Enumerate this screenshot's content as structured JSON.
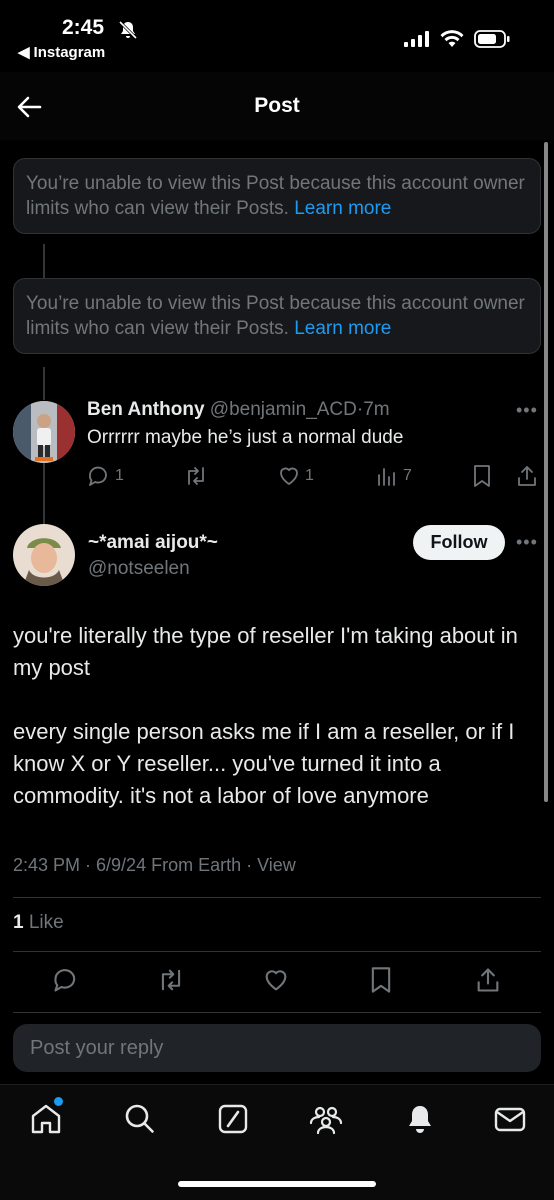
{
  "status": {
    "time": "2:45",
    "back_app": "Instagram"
  },
  "header": {
    "title": "Post"
  },
  "notices": [
    {
      "text": "You’re unable to view this Post because this account owner limits who can view their Posts.",
      "link": "Learn more"
    },
    {
      "text": "You’re unable to view this Post because this account owner limits who can view their Posts.",
      "link": "Learn more"
    }
  ],
  "reply_tweet": {
    "name": "Ben Anthony",
    "handle": "@benjamin_ACD",
    "separator": "·",
    "time": "7m",
    "text": "Orrrrrr maybe he’s just a normal dude",
    "replies": "1",
    "likes": "1",
    "views": "7"
  },
  "main_post": {
    "name": "~*amai aijou*~",
    "handle": "@notseelen",
    "follow_label": "Follow",
    "body": [
      "you're literally the type of reseller I'm taking about in my post",
      "every single person asks me if I am a reseller, or if I know X or Y reseller... you've turned it into a commodity. it's not a labor of love anymore"
    ],
    "meta": "2:43 PM · 6/9/24 From Earth · View",
    "like_count": "1",
    "like_label": "Like"
  },
  "reply_box": {
    "placeholder": "Post your reply"
  },
  "tabbar": {
    "items": [
      "home-icon",
      "search-icon",
      "grok-icon",
      "communities-icon",
      "notifications-icon",
      "messages-icon"
    ]
  },
  "colors": {
    "accent": "#1d9bf0",
    "muted": "#71767b",
    "background": "#000000"
  }
}
